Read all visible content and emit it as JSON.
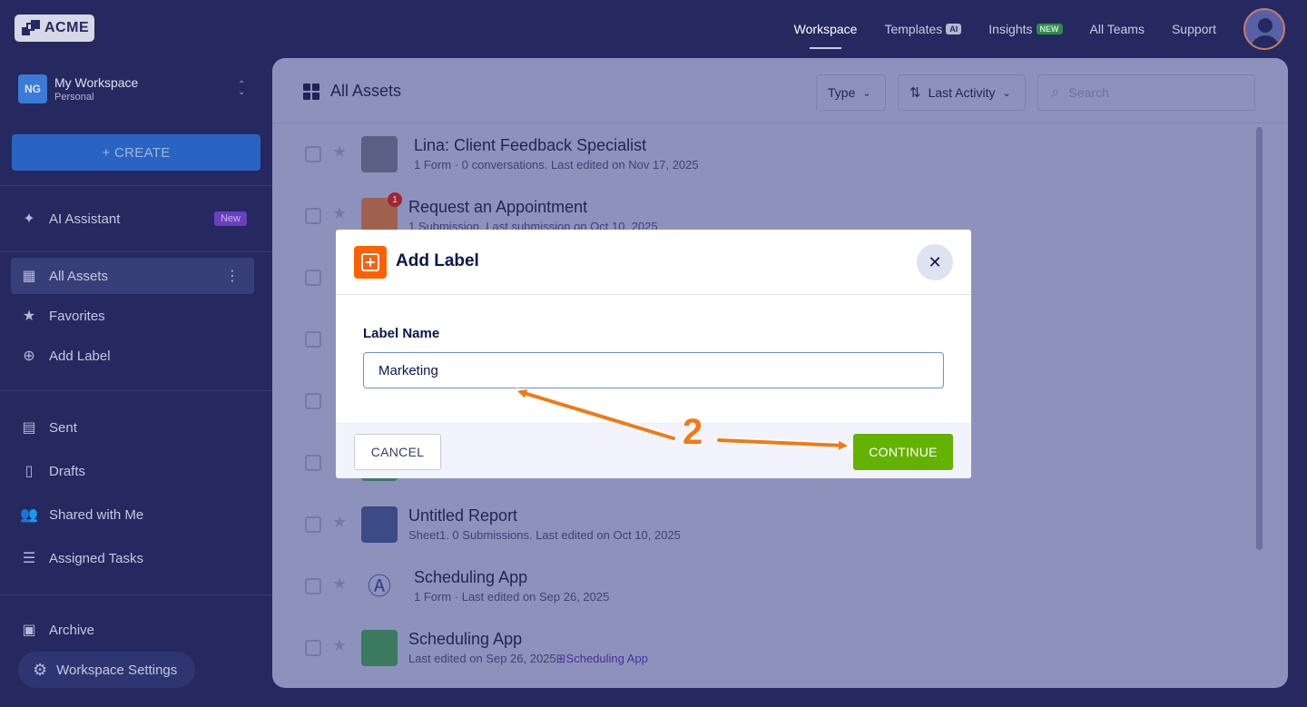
{
  "brand": {
    "name": "ACME"
  },
  "topnav": {
    "workspace": "Workspace",
    "templates": "Templates",
    "templates_badge": "AI",
    "insights": "Insights",
    "insights_badge": "NEW",
    "all_teams": "All Teams",
    "support": "Support"
  },
  "sidebar": {
    "workspace_initials": "NG",
    "workspace_name": "My Workspace",
    "workspace_type": "Personal",
    "create_label": "+ CREATE",
    "ai_assistant": "AI Assistant",
    "ai_badge": "New",
    "all_assets": "All Assets",
    "favorites": "Favorites",
    "add_label": "Add Label",
    "sent": "Sent",
    "drafts": "Drafts",
    "shared": "Shared with Me",
    "assigned": "Assigned Tasks",
    "archive": "Archive",
    "settings": "Workspace Settings"
  },
  "main": {
    "title": "All Assets",
    "type_filter": "Type",
    "sort_label": "Last Activity",
    "search_placeholder": "Search"
  },
  "assets": [
    {
      "title": "Lina: Client Feedback Specialist",
      "meta": "1 Form · 0 conversations. Last edited on Nov 17, 2025"
    },
    {
      "title": "Request an Appointment",
      "meta": "1 Submission. Last submission on Oct 10, 2025",
      "badge": "1"
    },
    {
      "title": "Untitled Report",
      "meta": "Sheet1. 0 Submissions. Last edited on Oct 10, 2025"
    },
    {
      "title": "Scheduling App",
      "meta": "1 Form · Last edited on Sep 26, 2025"
    },
    {
      "title": "Scheduling App",
      "meta": "Last edited on Sep 26, 2025",
      "link": "Scheduling App"
    }
  ],
  "modal": {
    "title": "Add Label",
    "field_label": "Label Name",
    "field_value": "Marketing",
    "cancel": "CANCEL",
    "continue": "CONTINUE"
  },
  "annotation": {
    "step": "2"
  },
  "colors": {
    "accent_orange": "#ff6100",
    "continue_green": "#64b200",
    "sidebar_bg": "#25295f",
    "create_blue": "#2a64c2"
  }
}
